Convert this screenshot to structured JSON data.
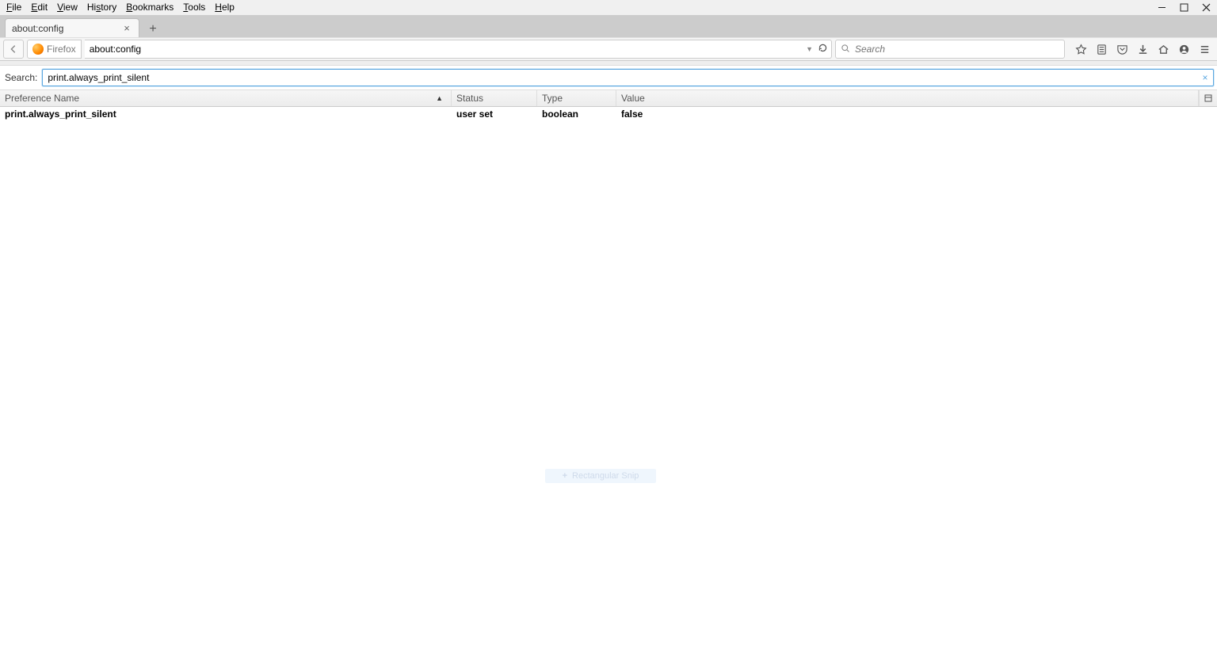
{
  "menubar": [
    "File",
    "Edit",
    "View",
    "History",
    "Bookmarks",
    "Tools",
    "Help"
  ],
  "tab": {
    "title": "about:config"
  },
  "identity_label": "Firefox",
  "url_value": "about:config",
  "search_placeholder": "Search",
  "cfg": {
    "search_label": "Search:",
    "search_value": "print.always_print_silent",
    "columns": {
      "pref": "Preference Name",
      "status": "Status",
      "type": "Type",
      "value": "Value"
    },
    "row": {
      "pref": "print.always_print_silent",
      "status": "user set",
      "type": "boolean",
      "value": "false"
    }
  },
  "snip_text": "Rectangular Snip"
}
